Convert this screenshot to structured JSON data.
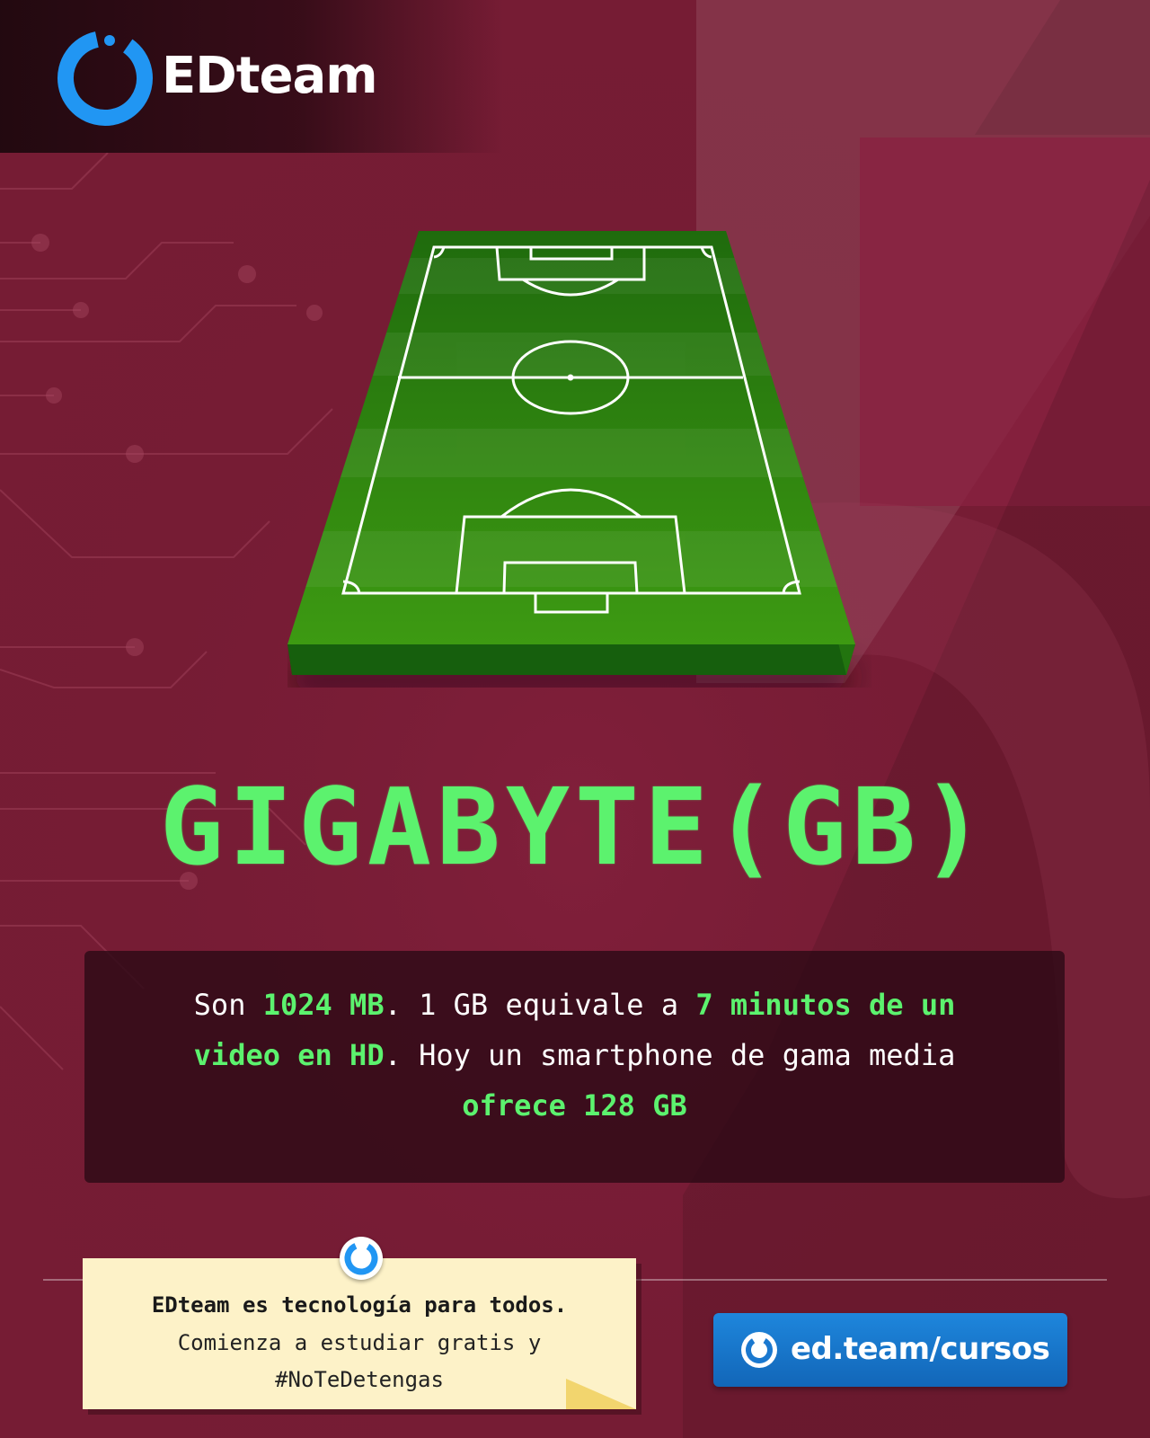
{
  "brand": {
    "name": "EDteam",
    "logo_icon": "edteam-ring-logo",
    "accent_color": "#2196f3"
  },
  "illustration": {
    "icon": "soccer-field"
  },
  "headline": "GIGABYTE(GB)",
  "description": {
    "parts": [
      {
        "text": "Son ",
        "highlight": false
      },
      {
        "text": "1024 MB",
        "highlight": true
      },
      {
        "text": ". 1 GB equivale a ",
        "highlight": false
      },
      {
        "text": "7 minutos de un video en HD",
        "highlight": true
      },
      {
        "text": ". Hoy un smartphone de gama media ",
        "highlight": false
      },
      {
        "text": "ofrece 128 GB",
        "highlight": true
      }
    ],
    "highlight_color": "#5cf26e"
  },
  "note": {
    "line1": "EDteam es tecnología para todos.",
    "line2": "Comienza a estudiar gratis y",
    "line3": "#NoTeDetengas"
  },
  "cta": {
    "label": "ed.team/cursos",
    "icon": "edteam-ring-icon"
  },
  "colors": {
    "background": "#7a1d36",
    "headline": "#5cf26e",
    "cta": "#1a78cf",
    "note": "#fdf2c8"
  }
}
